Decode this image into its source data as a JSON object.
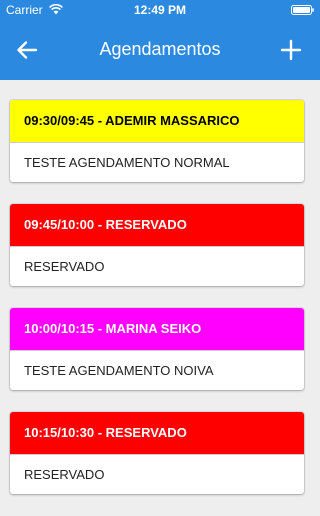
{
  "status_bar": {
    "carrier": "Carrier",
    "time": "12:49 PM",
    "wifi_icon": "wifi-icon",
    "battery_icon": "battery-icon"
  },
  "nav": {
    "title": "Agendamentos",
    "back_icon": "arrow-left-icon",
    "add_icon": "plus-icon"
  },
  "colors": {
    "primary": "#2b89e0",
    "background": "#eeeeee"
  },
  "appointments": [
    {
      "header": "09:30/09:45 - ADEMIR MASSARICO",
      "body": "TESTE AGENDAMENTO NORMAL",
      "header_bg": "#ffff00",
      "header_color": "#000000"
    },
    {
      "header": "09:45/10:00 - RESERVADO",
      "body": "RESERVADO",
      "header_bg": "#ff0000",
      "header_color": "#ffffff"
    },
    {
      "header": "10:00/10:15 - MARINA SEIKO",
      "body": "TESTE AGENDAMENTO NOIVA",
      "header_bg": "#ff00ff",
      "header_color": "#ffffff"
    },
    {
      "header": "10:15/10:30 - RESERVADO",
      "body": "RESERVADO",
      "header_bg": "#ff0000",
      "header_color": "#ffffff"
    }
  ]
}
